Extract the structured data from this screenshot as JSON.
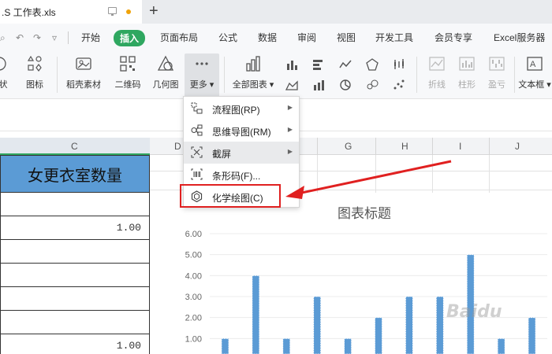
{
  "window": {
    "doc_tab_title": ".S 工作表.xls",
    "new_tab_icon": "+"
  },
  "menubar": {
    "tabs": [
      "开始",
      "插入",
      "页面布局",
      "公式",
      "数据",
      "审阅",
      "视图",
      "开发工具",
      "会员专享",
      "Excel服务器"
    ],
    "active_tab": "插入",
    "accent_color": "#2fa760"
  },
  "ribbon": {
    "buttons": [
      {
        "label": "状",
        "icon": "shape-icon"
      },
      {
        "label": "图标",
        "icon": "icons-icon"
      },
      {
        "label": "稻壳素材",
        "icon": "material-icon"
      },
      {
        "label": "二维码",
        "icon": "qrcode-icon"
      },
      {
        "label": "几何图",
        "icon": "geometry-icon"
      },
      {
        "label": "更多",
        "icon": "more-icon"
      },
      {
        "label": "全部图表",
        "icon": "all-charts-icon"
      },
      {
        "label": "折线",
        "icon": "sparkline-line-icon"
      },
      {
        "label": "柱形",
        "icon": "sparkline-column-icon"
      },
      {
        "label": "盈亏",
        "icon": "sparkline-winloss-icon"
      },
      {
        "label": "文本框",
        "icon": "textbox-icon"
      }
    ]
  },
  "more_menu": {
    "items": [
      {
        "label": "流程图(RP)",
        "icon": "flowchart-icon",
        "submenu": true
      },
      {
        "label": "思维导图(RM)",
        "icon": "mindmap-icon",
        "submenu": true
      },
      {
        "label": "截屏",
        "icon": "screenshot-icon",
        "submenu": true
      },
      {
        "label": "条形码(F)...",
        "icon": "barcode-icon",
        "submenu": false
      },
      {
        "label": "化学绘图(C)",
        "icon": "chemistry-icon",
        "submenu": false
      }
    ],
    "hovered": "截屏",
    "highlighted": "化学绘图(C)",
    "highlight_color": "#e02020"
  },
  "sheet": {
    "columns": [
      "C",
      "D",
      "G",
      "H",
      "I",
      "J"
    ],
    "selected_column": "C",
    "header_cell": "女更衣室数量",
    "header_fill": "#5b9bd5",
    "rows": [
      "",
      "1.00",
      "",
      "",
      "",
      "",
      "1.00"
    ]
  },
  "chart_data": {
    "type": "bar",
    "title": "图表标题",
    "ylim": [
      0,
      6
    ],
    "y_ticks": [
      "6.00",
      "5.00",
      "4.00",
      "3.00",
      "2.00",
      "1.00"
    ],
    "values": [
      1,
      4,
      1,
      3,
      1,
      2,
      3,
      3,
      5,
      1,
      2
    ],
    "bar_color": "#5b9bd5"
  },
  "watermark": "Baidu"
}
